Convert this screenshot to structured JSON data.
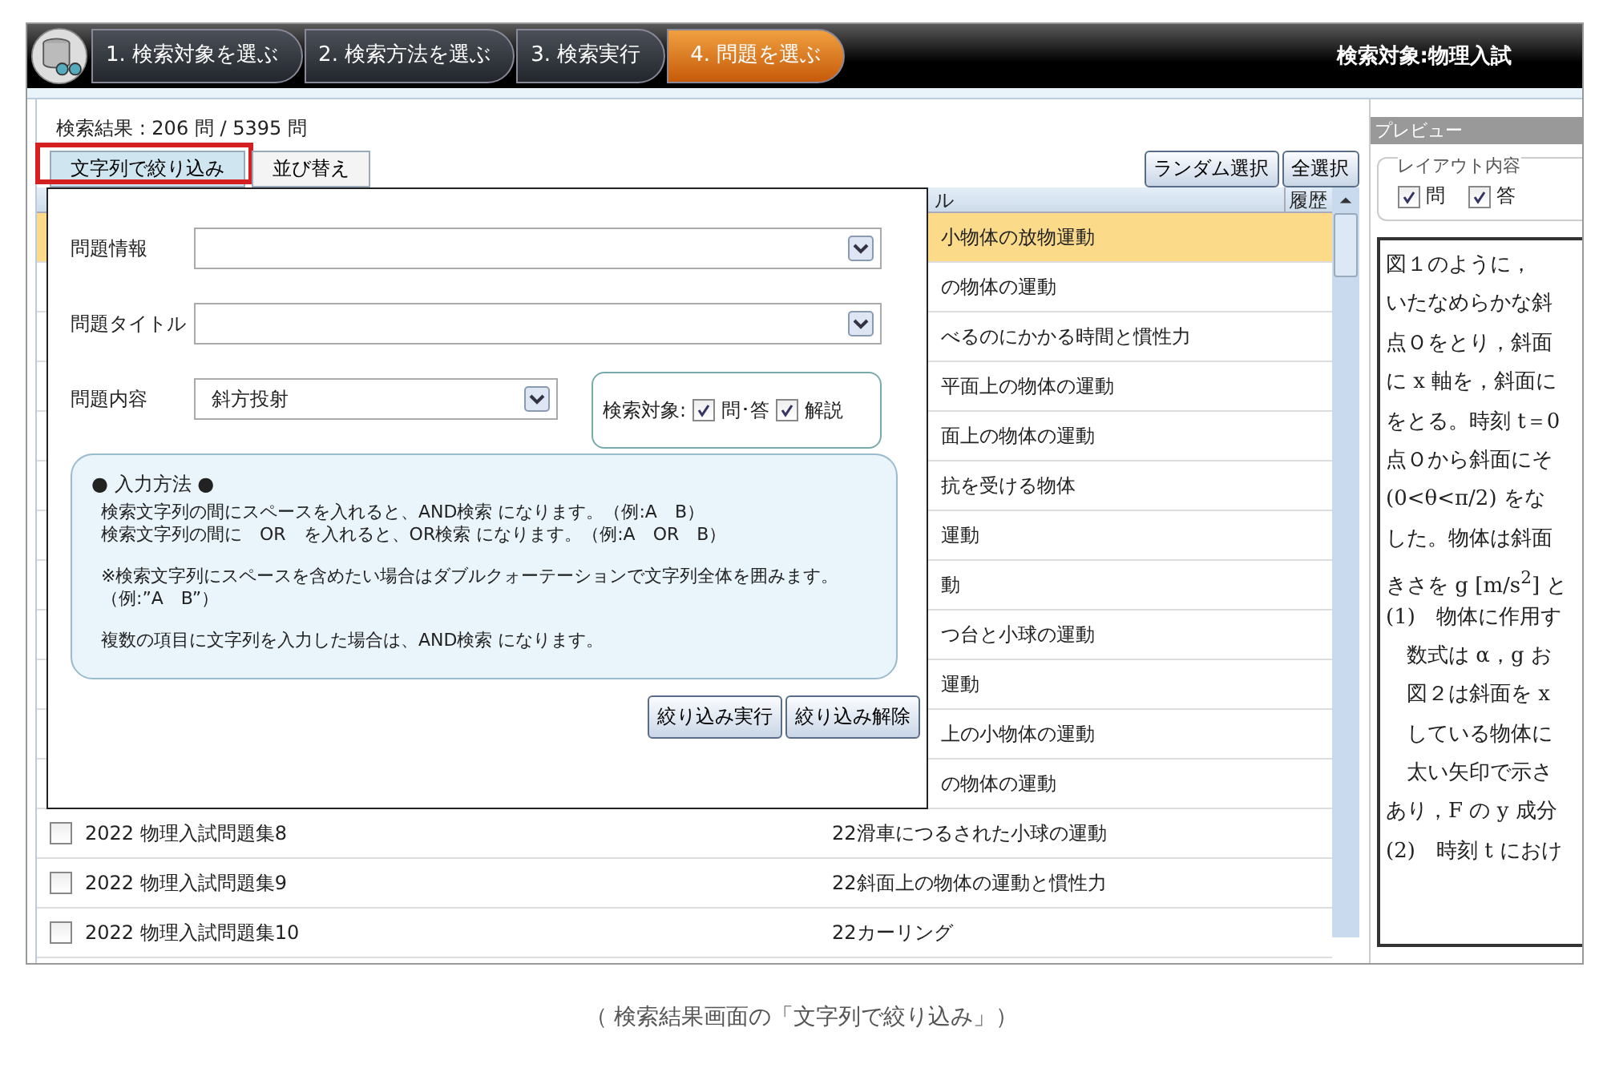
{
  "header": {
    "steps": [
      {
        "label": "1. 検索対象を選ぶ",
        "selected": false
      },
      {
        "label": "2. 検索方法を選ぶ",
        "selected": false
      },
      {
        "label": "3. 検索実行",
        "selected": false
      },
      {
        "label": "4. 問題を選ぶ",
        "selected": true
      }
    ],
    "target": "検索対象:物理入試"
  },
  "results": {
    "summary": "検索結果 : 206 問 / 5395 問",
    "tabs": [
      {
        "label": "文字列で絞り込み",
        "selected": true,
        "highlighted": true
      },
      {
        "label": "並び替え",
        "selected": false,
        "highlighted": false
      }
    ],
    "buttons": [
      "ランダム選択",
      "全選択"
    ],
    "table": {
      "columns": [
        "ル",
        "履歴"
      ],
      "rows": [
        {
          "title": "小物体の放物運動",
          "selected": true
        },
        {
          "title": "の物体の運動",
          "selected": false
        },
        {
          "title": "べるのにかかる時間と慣性力",
          "selected": false
        },
        {
          "title": "平面上の物体の運動",
          "selected": false
        },
        {
          "title": "面上の物体の運動",
          "selected": false
        },
        {
          "title": "抗を受ける物体",
          "selected": false
        },
        {
          "title": "運動",
          "selected": false
        },
        {
          "title": "動",
          "selected": false
        },
        {
          "title": "つ台と小球の運動",
          "selected": false
        },
        {
          "title": "運動",
          "selected": false
        },
        {
          "title": "上の小物体の運動",
          "selected": false
        },
        {
          "title": "の物体の運動",
          "selected": false
        },
        {
          "collection": "2022 物理入試問題集8",
          "title": "22滑車につるされた小球の運動",
          "selected": false,
          "checked": false
        },
        {
          "collection": "2022 物理入試問題集9",
          "title": "22斜面上の物体の運動と慣性力",
          "selected": false,
          "checked": false
        },
        {
          "collection": "2022 物理入試問題集10",
          "title": "22カーリング",
          "selected": false,
          "checked": false
        }
      ]
    }
  },
  "filter_dialog": {
    "fields": [
      {
        "label": "問題情報"
      },
      {
        "label": "問題タイトル"
      },
      {
        "label": "問題内容",
        "value": "斜方投射"
      }
    ],
    "search_target": {
      "label": "検索対象:",
      "options": [
        {
          "label": "問･答",
          "checked": true
        },
        {
          "label": "解説",
          "checked": true
        }
      ]
    },
    "help": {
      "title": "● 入力方法 ●",
      "paragraphs": [
        [
          "検索文字列の間にスペースを入れると、AND検索 になります。（例:A　B）",
          "検索文字列の間に　OR　を入れると、OR検索 になります。（例:A　OR　B）"
        ],
        [
          "※検索文字列にスペースを含めたい場合はダブルクォーテーションで文字列全体を囲みます。",
          "（例:”A　B”）"
        ],
        [
          "複数の項目に文字列を入力した場合は、AND検索 になります。"
        ]
      ]
    },
    "buttons": [
      "絞り込み実行",
      "絞り込み解除"
    ]
  },
  "preview": {
    "title": "プレビュー",
    "layout": {
      "legend": "レイアウト内容",
      "options": [
        {
          "label": "問",
          "checked": true
        },
        {
          "label": "答",
          "checked": true
        }
      ]
    },
    "document_lines": [
      "図１のように，",
      "いたなめらかな斜",
      "点Ｏをとり，斜面",
      "に x 軸を，斜面に",
      "をとる。時刻 t＝0",
      "点Ｏから斜面にそ",
      "(0<θ<π/2) をな",
      "した。物体は斜面",
      "きさを g [m/s$^{2}$] と",
      "(1)　物体に作用す",
      "　数式は α，g お",
      "　図２は斜面を x",
      "　している物体に",
      "　太い矢印で示さ",
      "あり，F の y 成分",
      "(2)　時刻 t におけ"
    ]
  },
  "caption": "（ 検索結果画面の「文字列で絞り込み」）"
}
